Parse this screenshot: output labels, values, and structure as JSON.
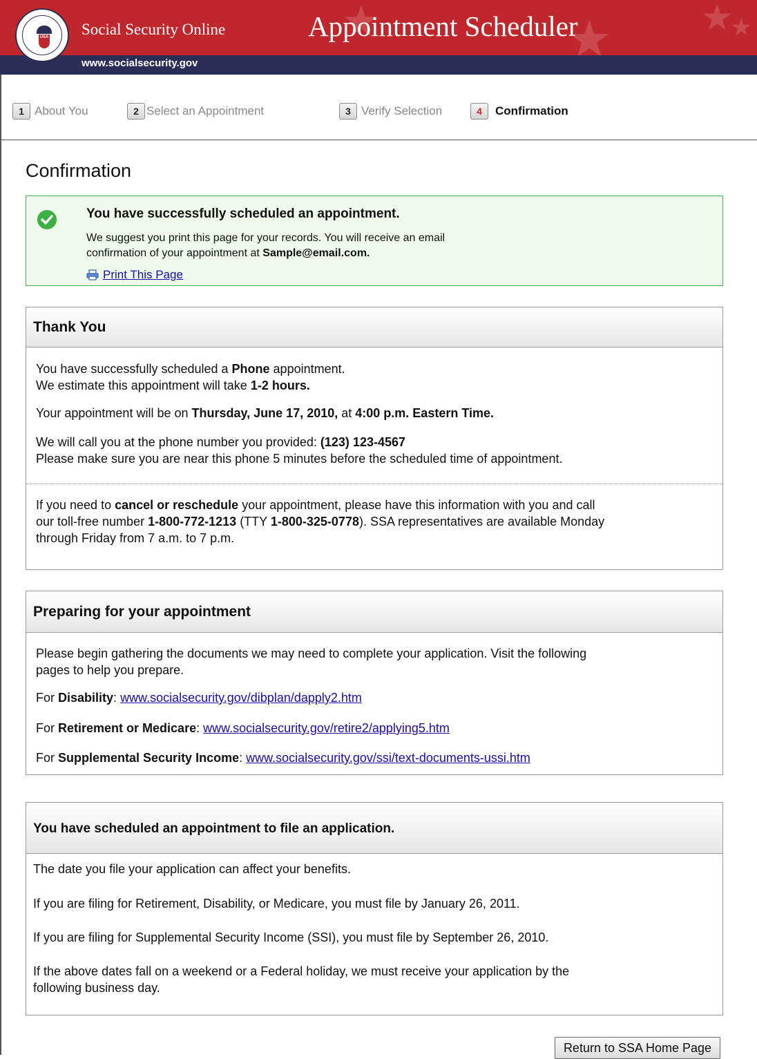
{
  "header": {
    "site_name": "Social Security Online",
    "site_url": "www.socialsecurity.gov",
    "app_title": "Appointment Scheduler",
    "seal_text": "USA",
    "colors": {
      "red": "#c0272d",
      "navy": "#2b2e55"
    }
  },
  "steps": [
    {
      "num": "1",
      "label": "About You"
    },
    {
      "num": "2",
      "label": "Select an Appointment"
    },
    {
      "num": "3",
      "label": "Verify Selection"
    },
    {
      "num": "4",
      "label": "Confirmation"
    }
  ],
  "page_title": "Confirmation",
  "success": {
    "heading": "You have successfully scheduled an appointment.",
    "line1": "We suggest you print this page for your records. You will receive an email",
    "line2_prefix": "confirmation of your appointment at",
    "email": "Sample@email.com.",
    "print_label": "Print This Page",
    "icon": "check-circle-icon",
    "print_icon": "printer-icon"
  },
  "thank_you": {
    "title": "Thank You",
    "l1_a": "You have successfully scheduled a ",
    "l1_b": "Phone",
    "l1_c": " appointment.",
    "l2_a": "We estimate this appointment will take ",
    "l2_b": "1-2 hours.",
    "l3_a": "Your appointment will be on ",
    "l3_b": "Thursday, June 17, 2010,",
    "l3_c": " at ",
    "l3_d": "4:00 p.m. Eastern Time.",
    "l4_a": "We will call you at the phone number you provided: ",
    "l4_b": "(123) 123-4567",
    "l5": "Please make sure you are near this phone 5 minutes before the scheduled time of appointment.",
    "c1_a": "If you need to ",
    "c1_b": "cancel or reschedule",
    "c1_c": " your appointment, please have this information with you and call",
    "c2_a": "our toll-free number ",
    "c2_b": "1-800-772-1213",
    "c2_c": " (TTY ",
    "c2_d": "1-800-325-0778",
    "c2_e": "). SSA representatives are available Monday",
    "c3": "through Friday from 7 a.m. to 7 p.m."
  },
  "preparing": {
    "title": "Preparing for your appointment",
    "intro1": "Please begin gathering the documents we may need to complete your application. Visit the following",
    "intro2": "pages to help you prepare.",
    "links": [
      {
        "prefix": "For ",
        "topic": "Disability",
        "sep": ": ",
        "url": "www.socialsecurity.gov/dibplan/dapply2.htm"
      },
      {
        "prefix": "For ",
        "topic": "Retirement or Medicare",
        "sep": ": ",
        "url": "www.socialsecurity.gov/retire2/applying5.htm"
      },
      {
        "prefix": "For ",
        "topic": "Supplemental Security Income",
        "sep": ": ",
        "url": "www.socialsecurity.gov/ssi/text-documents-ussi.htm"
      }
    ]
  },
  "file_app": {
    "title": "You have scheduled an appointment to file an application.",
    "p1": "The date you file your application can affect your benefits.",
    "p2": "If you are filing for Retirement, Disability, or Medicare, you must file by January 26, 2011.",
    "p3": "If you are filing for Supplemental Security Income (SSI), you must file by September 26, 2010.",
    "p4a": "If the above dates fall on a weekend or a Federal holiday, we must receive your application by the",
    "p4b": "following business day."
  },
  "return_button": "Return to SSA Home Page"
}
